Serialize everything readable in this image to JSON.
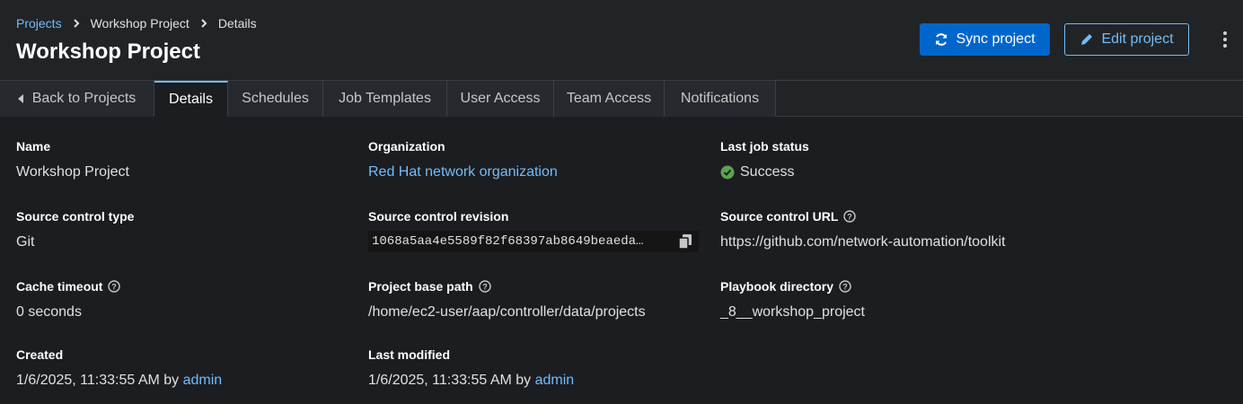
{
  "breadcrumb": {
    "root": "Projects",
    "project": "Workshop Project",
    "current": "Details"
  },
  "title": "Workshop Project",
  "actions": {
    "sync_label": "Sync project",
    "edit_label": "Edit project"
  },
  "tabs": {
    "back": "Back to Projects",
    "details": "Details",
    "schedules": "Schedules",
    "job_templates": "Job Templates",
    "user_access": "User Access",
    "team_access": "Team Access",
    "notifications": "Notifications"
  },
  "details": {
    "name": {
      "label": "Name",
      "value": "Workshop Project"
    },
    "organization": {
      "label": "Organization",
      "value": "Red Hat network organization"
    },
    "last_job_status": {
      "label": "Last job status",
      "value": "Success"
    },
    "scm_type": {
      "label": "Source control type",
      "value": "Git"
    },
    "scm_revision": {
      "label": "Source control revision",
      "value": "1068a5aa4e5589f82f68397ab8649beaeda…"
    },
    "scm_url": {
      "label": "Source control URL",
      "value": "https://github.com/network-automation/toolkit"
    },
    "cache_timeout": {
      "label": "Cache timeout",
      "value": "0 seconds"
    },
    "base_path": {
      "label": "Project base path",
      "value": "/home/ec2-user/aap/controller/data/projects"
    },
    "playbook_dir": {
      "label": "Playbook directory",
      "value": "_8__workshop_project"
    },
    "created": {
      "label": "Created",
      "date": "1/6/2025, 11:33:55 AM by ",
      "user": "admin"
    },
    "modified": {
      "label": "Last modified",
      "date": "1/6/2025, 11:33:55 AM by ",
      "user": "admin"
    }
  },
  "colors": {
    "accent": "#73bcf7",
    "primary": "#0066cc",
    "success": "#5ba352",
    "background": "#1b1d21"
  }
}
